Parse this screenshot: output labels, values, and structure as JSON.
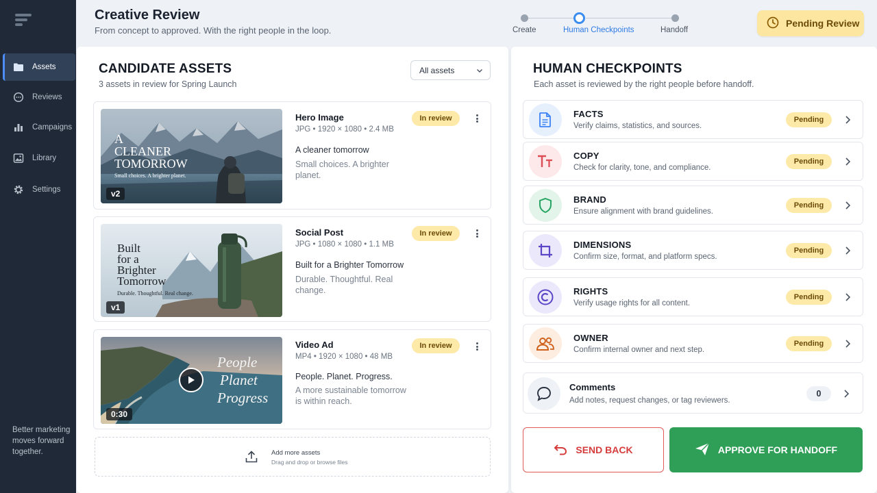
{
  "sidebar": {
    "items": [
      {
        "label": "Assets",
        "icon": "folder-icon",
        "active": true
      },
      {
        "label": "Reviews",
        "icon": "chat-icon"
      },
      {
        "label": "Campaigns",
        "icon": "bar-chart-icon"
      },
      {
        "label": "Library",
        "icon": "image-icon"
      },
      {
        "label": "Settings",
        "icon": "gear-icon"
      }
    ],
    "tagline": "Better marketing moves forward together."
  },
  "header": {
    "title": "Creative Review",
    "subtitle": "From concept to approved. With the right people in the loop.",
    "steps": [
      "Create",
      "Human Checkpoints",
      "Handoff"
    ],
    "active_step": 1,
    "status": "Pending Review"
  },
  "assets_panel": {
    "title": "CANDIDATE ASSETS",
    "subtitle": "3 assets in review for Spring Launch",
    "filter": "All assets",
    "assets": [
      {
        "name": "Hero Image",
        "meta": "JPG • 1920 × 1080 • 2.4 MB",
        "headline": "A cleaner tomorrow",
        "description": "Small choices. A brighter planet.",
        "status": "In review",
        "version": "v2",
        "thumb_lines": [
          "A",
          "CLEANER",
          "TOMORROW"
        ],
        "thumb_caption": "Small choices. A brighter planet."
      },
      {
        "name": "Social Post",
        "meta": "JPG • 1080 × 1080 • 1.1 MB",
        "headline": "Built for a Brighter Tomorrow",
        "description": "Durable. Thoughtful. Real change.",
        "status": "In review",
        "version": "v1",
        "thumb_lines": [
          "Built",
          "for a",
          "Brighter",
          "Tomorrow"
        ],
        "thumb_caption": "Durable. Thoughtful. Real change."
      },
      {
        "name": "Video Ad",
        "meta": "MP4 • 1920 × 1080 • 48 MB",
        "headline": "People. Planet. Progress.",
        "description": "A more sustainable tomorrow is within reach.",
        "status": "In review",
        "duration": "0:30",
        "thumb_lines": [
          "People",
          "Planet",
          "Progress"
        ]
      }
    ],
    "upload": {
      "title": "Add more assets",
      "subtitle": "Drag and drop or browse files"
    }
  },
  "checkpoints_panel": {
    "title": "HUMAN CHECKPOINTS",
    "subtitle": "Each asset is reviewed by the right people before handoff.",
    "checkpoints": [
      {
        "title": "FACTS",
        "description": "Verify claims, statistics, and sources.",
        "status": "Pending",
        "icon": "document-icon",
        "color": "#3b82f6"
      },
      {
        "title": "COPY",
        "description": "Check for clarity, tone, and compliance.",
        "status": "Pending",
        "icon": "text-icon",
        "color": "#dc4d56"
      },
      {
        "title": "BRAND",
        "description": "Ensure alignment with brand guidelines.",
        "status": "Pending",
        "icon": "shield-icon",
        "color": "#27a563"
      },
      {
        "title": "DIMENSIONS",
        "description": "Confirm size, format, and platform specs.",
        "status": "Pending",
        "icon": "crop-icon",
        "color": "#5b46c7"
      },
      {
        "title": "RIGHTS",
        "description": "Verify usage rights for all content.",
        "status": "Pending",
        "icon": "copyright-icon",
        "color": "#5b46c7"
      },
      {
        "title": "OWNER",
        "description": "Confirm internal owner and next step.",
        "status": "Pending",
        "icon": "users-icon",
        "color": "#d0611d"
      }
    ],
    "comments": {
      "title": "Comments",
      "description": "Add notes, request changes, or tag reviewers.",
      "count": "0"
    },
    "send_back_label": "SEND BACK",
    "approve_label": "APPROVE FOR HANDOFF"
  }
}
